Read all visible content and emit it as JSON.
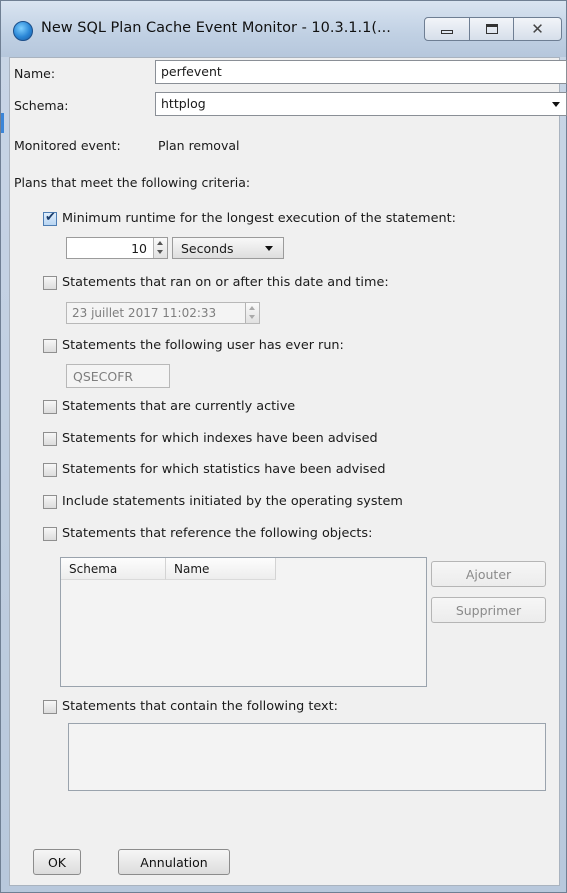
{
  "window": {
    "title": "New SQL Plan Cache Event Monitor - 10.3.1.1(...",
    "controls": {
      "minimize": "minimize-icon",
      "maximize": "maximize-icon",
      "close": "close-icon"
    }
  },
  "form": {
    "name_label": "Name:",
    "name_value": "perfevent",
    "schema_label": "Schema:",
    "schema_value": "httplog",
    "monitored_event_label": "Monitored event:",
    "monitored_event_value": "Plan removal",
    "criteria_heading": "Plans that meet the following criteria:"
  },
  "criteria": {
    "min_runtime": {
      "label": "Minimum runtime for the longest execution of the statement:",
      "checked": true,
      "value": "10",
      "unit": "Seconds"
    },
    "ran_after": {
      "label": "Statements that ran on or after this date and time:",
      "checked": false,
      "value": "23 juillet 2017 11:02:33"
    },
    "user_run": {
      "label": "Statements the following user has ever run:",
      "checked": false,
      "value": "QSECOFR"
    },
    "currently_active": {
      "label": "Statements that are currently active",
      "checked": false
    },
    "indexes_advised": {
      "label": "Statements for which indexes have been advised",
      "checked": false
    },
    "stats_advised": {
      "label": "Statements for which statistics have been advised",
      "checked": false
    },
    "os_initiated": {
      "label": "Include statements initiated by the operating system",
      "checked": false
    },
    "reference_objects": {
      "label": "Statements that reference the following objects:",
      "checked": false,
      "columns": [
        "Schema",
        "Name"
      ],
      "add_button": "Ajouter",
      "remove_button": "Supprimer"
    },
    "contain_text": {
      "label": "Statements that contain the following text:",
      "checked": false
    }
  },
  "footer": {
    "ok": "OK",
    "cancel": "Annulation"
  }
}
